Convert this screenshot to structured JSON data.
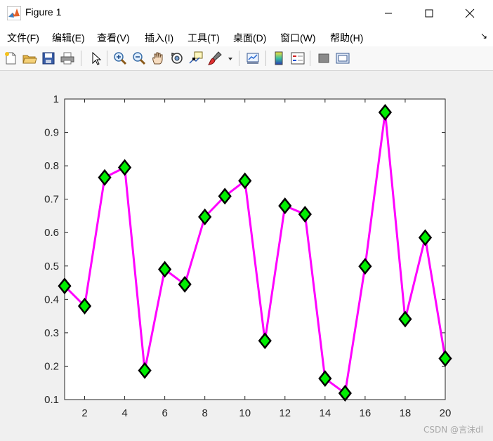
{
  "window": {
    "title": "Figure 1",
    "controls": {
      "minimize": "—",
      "maximize": "☐",
      "close": "✕"
    }
  },
  "menu": {
    "items": [
      "文件(F)",
      "编辑(E)",
      "查看(V)",
      "插入(I)",
      "工具(T)",
      "桌面(D)",
      "窗口(W)",
      "帮助(H)"
    ],
    "overflow_icon": "dock-arrow-icon"
  },
  "toolbar": {
    "icons": [
      "new-figure-icon",
      "open-file-icon",
      "save-icon",
      "print-icon",
      "select-arrow-icon",
      "zoom-in-icon",
      "zoom-out-icon",
      "pan-hand-icon",
      "rotate-3d-icon",
      "data-cursor-icon",
      "brush-icon",
      "brush-dropdown-icon",
      "link-plot-icon",
      "colorbar-icon",
      "legend-icon",
      "hide-plot-tools-icon",
      "show-plot-tools-icon"
    ]
  },
  "chart_data": {
    "type": "line",
    "title": "",
    "xlabel": "",
    "ylabel": "",
    "xlim": [
      1,
      20
    ],
    "ylim": [
      0.1,
      1
    ],
    "xticks": [
      2,
      4,
      6,
      8,
      10,
      12,
      14,
      16,
      18,
      20
    ],
    "xtick_labels": [
      "2",
      "4",
      "6",
      "8",
      "10",
      "12",
      "14",
      "16",
      "18",
      "20"
    ],
    "yticks": [
      0.1,
      0.2,
      0.3,
      0.4,
      0.5,
      0.6,
      0.7,
      0.8,
      0.9,
      1
    ],
    "ytick_labels": [
      "0.1",
      "0.2",
      "0.3",
      "0.4",
      "0.5",
      "0.6",
      "0.7",
      "0.8",
      "0.9",
      "1"
    ],
    "grid": false,
    "series": [
      {
        "x": [
          1,
          2,
          3,
          4,
          5,
          6,
          7,
          8,
          9,
          10,
          11,
          12,
          13,
          14,
          15,
          16,
          17,
          18,
          19,
          20
        ],
        "y": [
          0.44,
          0.38,
          0.765,
          0.795,
          0.187,
          0.49,
          0.445,
          0.647,
          0.709,
          0.755,
          0.276,
          0.68,
          0.655,
          0.163,
          0.119,
          0.499,
          0.96,
          0.341,
          0.585,
          0.223
        ],
        "line_color": "#ff00ff",
        "marker": "diamond",
        "marker_face": "#00ee00",
        "marker_edge": "#000000"
      }
    ]
  },
  "watermark": "CSDN @言沫dl"
}
